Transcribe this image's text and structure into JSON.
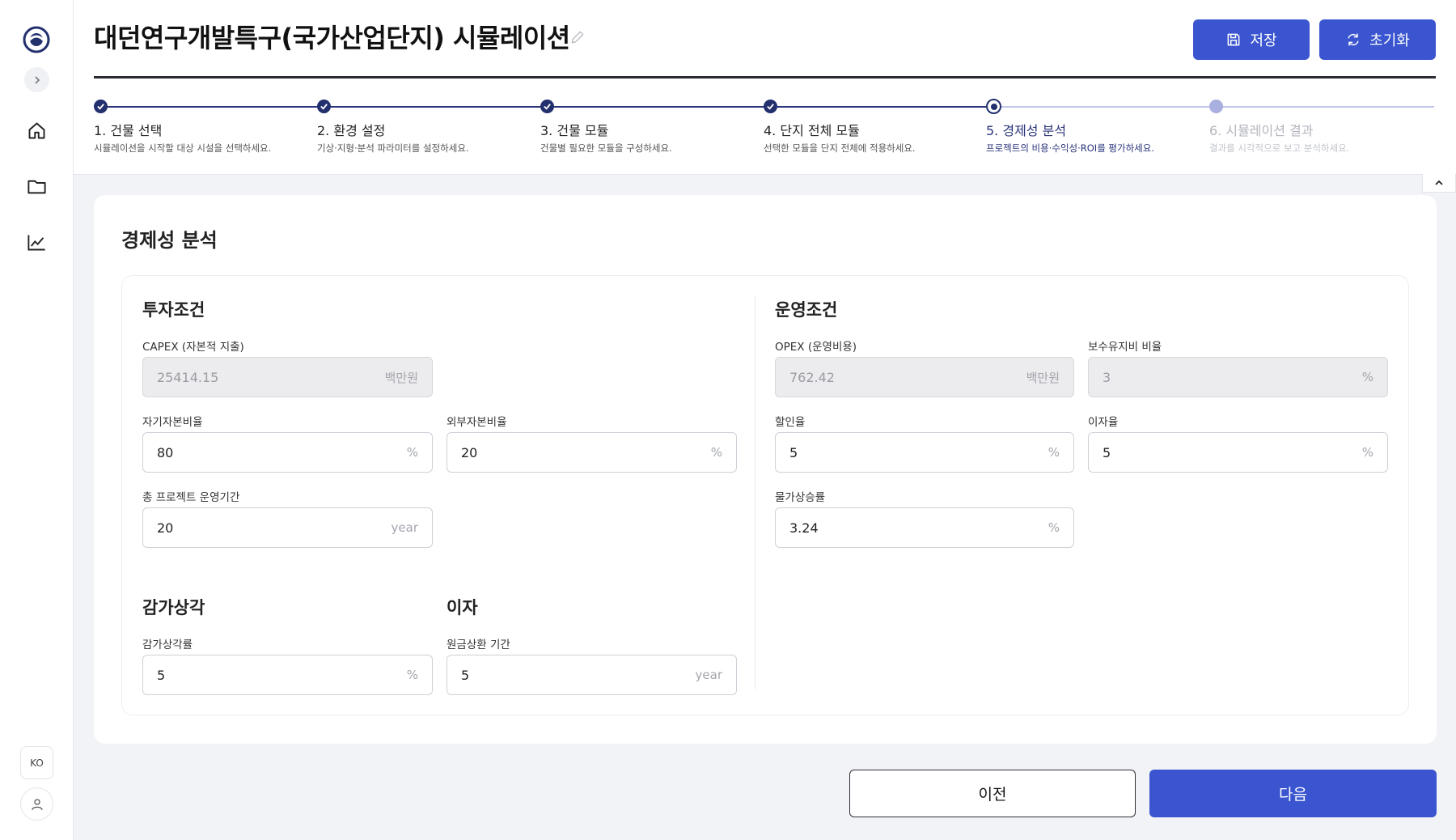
{
  "app": {
    "title": "대던연구개발특구(국가산업단지) 시뮬레이션",
    "save_label": "저장",
    "reset_label": "초기화",
    "accent": "#3a55cf"
  },
  "sidebar": {
    "lang": "KO",
    "items": [
      {
        "icon": "home-icon"
      },
      {
        "icon": "folder-icon"
      },
      {
        "icon": "chart-line-icon"
      }
    ]
  },
  "stepper": {
    "steps": [
      {
        "title": "1. 건물 선택",
        "desc": "시뮬레이션을 시작할 대상 시설을 선택하세요.",
        "state": "done"
      },
      {
        "title": "2. 환경 설정",
        "desc": "기상·지형·분석 파라미터를 설정하세요.",
        "state": "done"
      },
      {
        "title": "3. 건물 모듈",
        "desc": "건물별 필요한 모듈을 구성하세요.",
        "state": "done"
      },
      {
        "title": "4. 단지 전체 모듈",
        "desc": "선택한 모듈을 단지 전체에 적용하세요.",
        "state": "done"
      },
      {
        "title": "5. 경제성 분석",
        "desc": "프로젝트의 비용·수익성·ROI를 평가하세요.",
        "state": "current"
      },
      {
        "title": "6. 시뮬레이션 결과",
        "desc": "결과를 시각적으로 보고 분석하세요.",
        "state": "upcoming"
      }
    ]
  },
  "main": {
    "title": "경제성 분석",
    "investment": {
      "title": "투자조건",
      "capex": {
        "label": "CAPEX (자본적 지출)",
        "value": "25414.15",
        "unit": "백만원"
      },
      "equity_ratio": {
        "label": "자기자본비율",
        "value": "80",
        "unit": "%"
      },
      "debt_ratio": {
        "label": "외부자본비율",
        "value": "20",
        "unit": "%"
      },
      "period": {
        "label": "총 프로젝트 운영기간",
        "value": "20",
        "unit": "year"
      }
    },
    "operation": {
      "title": "운영조건",
      "opex": {
        "label": "OPEX (운영비용)",
        "value": "762.42",
        "unit": "백만원"
      },
      "maintenance": {
        "label": "보수유지비 비율",
        "value": "3",
        "unit": "%"
      },
      "discount": {
        "label": "할인율",
        "value": "5",
        "unit": "%"
      },
      "interest": {
        "label": "이자율",
        "value": "5",
        "unit": "%"
      },
      "inflation": {
        "label": "물가상승률",
        "value": "3.24",
        "unit": "%"
      }
    },
    "depreciation": {
      "title": "감가상각",
      "rate": {
        "label": "감가상각률",
        "value": "5",
        "unit": "%"
      }
    },
    "interest_sec": {
      "title": "이자",
      "repayment": {
        "label": "원금상환 기간",
        "value": "5",
        "unit": "year"
      }
    }
  },
  "footer": {
    "prev_label": "이전",
    "next_label": "다음"
  }
}
